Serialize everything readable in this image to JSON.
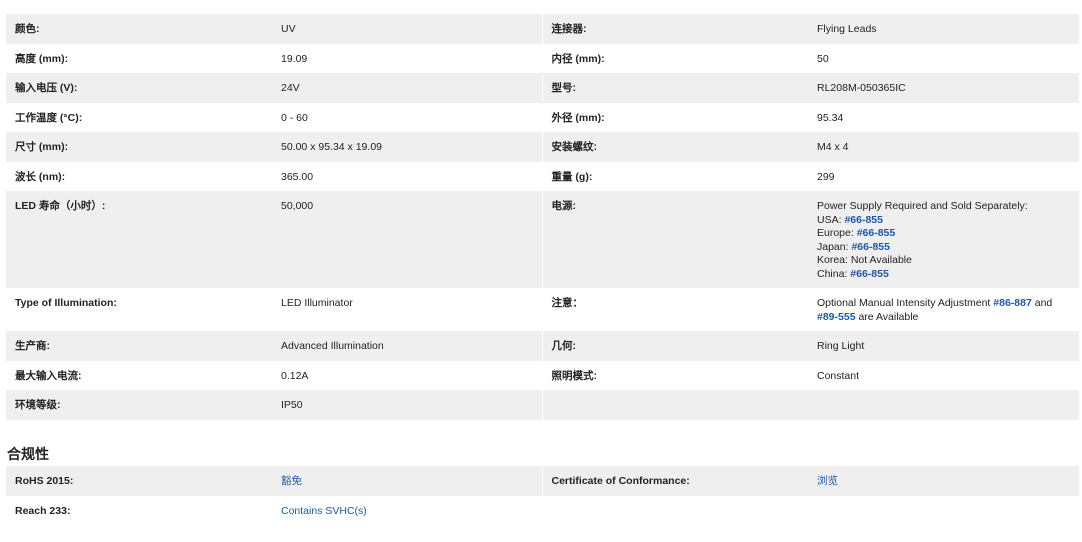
{
  "specs": [
    {
      "l1": "颜色:",
      "v1": "UV",
      "l2": "连接器:",
      "v2": "Flying Leads"
    },
    {
      "l1": "高度 (mm):",
      "v1": "19.09",
      "l2": "内径 (mm):",
      "v2": "50"
    },
    {
      "l1": "输入电压 (V):",
      "v1": "24V",
      "l2": "型号:",
      "v2": "RL208M-050365IC"
    },
    {
      "l1": "工作温度 (°C):",
      "v1": "0 - 60",
      "l2": "外径 (mm):",
      "v2": "95.34"
    },
    {
      "l1": "尺寸 (mm):",
      "v1": "50.00 x 95.34 x 19.09",
      "l2": "安装螺纹:",
      "v2": "M4 x 4"
    },
    {
      "l1": "波长 (nm):",
      "v1": "365.00",
      "l2": "重量 (g):",
      "v2": "299"
    },
    {
      "l1": "LED 寿命（小时）:",
      "v1": "50,000",
      "l2": "电源:"
    },
    {
      "l1": "Type of Illumination:",
      "v1": "LED Illuminator",
      "l2": "注意："
    },
    {
      "l1": "生产商:",
      "v1": "Advanced Illumination",
      "l2": "几何:",
      "v2": "Ring Light"
    },
    {
      "l1": "最大输入电流:",
      "v1": "0.12A",
      "l2": "照明模式:",
      "v2": "Constant"
    },
    {
      "l1": "环境等级:",
      "v1": "IP50"
    }
  ],
  "power_supply": {
    "intro": "Power Supply Required and Sold Separately:",
    "usa_label": "USA: ",
    "usa_link": "#66-855",
    "europe_label": "Europe: ",
    "europe_link": "#66-855",
    "japan_label": "Japan: ",
    "japan_link": "#66-855",
    "korea_text": "Korea: Not Available",
    "china_label": "China: ",
    "china_link": "#66-855"
  },
  "note": {
    "pre": "Optional Manual Intensity Adjustment ",
    "link1": "#86-887",
    "mid": " and",
    "link2": "#89-555",
    "post": " are Available"
  },
  "compliance": {
    "title": "合规性",
    "rohs_label": "RoHS 2015:",
    "rohs_value": "豁免",
    "coc_label": "Certificate of Conformance:",
    "coc_value": "浏览",
    "reach_label": "Reach 233:",
    "reach_value": "Contains SVHC(s)"
  }
}
